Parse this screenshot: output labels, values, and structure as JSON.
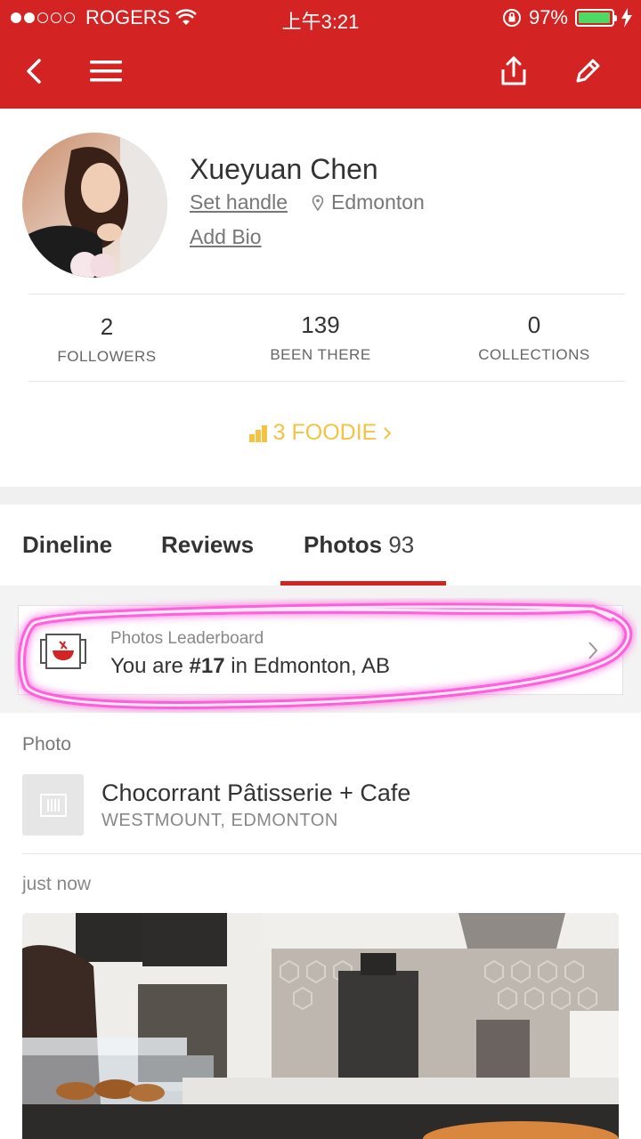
{
  "status_bar": {
    "carrier": "ROGERS",
    "time": "上午3:21",
    "battery": "97%",
    "battery_level": 0.97
  },
  "nav": {
    "back_icon": "chevron-left-icon",
    "menu_icon": "hamburger-icon",
    "share_icon": "share-icon",
    "edit_icon": "pencil-icon"
  },
  "profile": {
    "name": "Xueyuan Chen",
    "set_handle": "Set handle",
    "location": "Edmonton",
    "add_bio": "Add Bio"
  },
  "stats": [
    {
      "value": "2",
      "label": "FOLLOWERS"
    },
    {
      "value": "139",
      "label": "BEEN THERE"
    },
    {
      "value": "0",
      "label": "COLLECTIONS"
    }
  ],
  "foodie": {
    "label": "3 FOODIE",
    "color": "#f5c343"
  },
  "tabs": [
    {
      "label": "Dineline",
      "count": ""
    },
    {
      "label": "Reviews",
      "count": ""
    },
    {
      "label": "Photos",
      "count": "93"
    }
  ],
  "leaderboard": {
    "label": "Photos Leaderboard",
    "prefix": "You are ",
    "rank": "#17",
    "suffix": " in Edmonton, AB"
  },
  "feed": {
    "section_label": "Photo",
    "business_name": "Chocorrant Pâtisserie + Cafe",
    "business_location": "WESTMOUNT, EDMONTON",
    "timestamp": "just now"
  },
  "colors": {
    "brand_red": "#d32323",
    "highlight_pink": "#ff4fd8",
    "battery_green": "#4cd964"
  }
}
